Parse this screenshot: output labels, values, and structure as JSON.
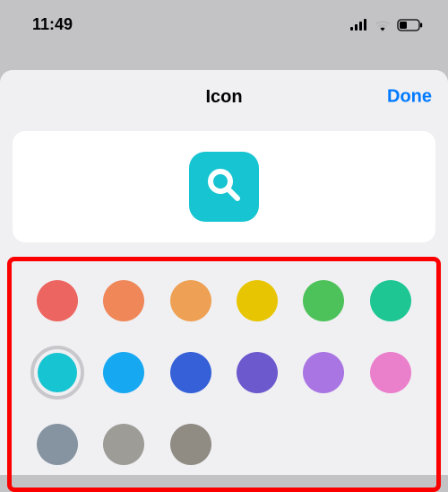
{
  "statusBar": {
    "time": "11:49"
  },
  "sheet": {
    "title": "Icon",
    "doneLabel": "Done"
  },
  "preview": {
    "iconName": "search-icon",
    "bgColor": "#17c4d1"
  },
  "colors": [
    {
      "name": "red",
      "hex": "#ec6560",
      "selected": false
    },
    {
      "name": "orange",
      "hex": "#ef8759",
      "selected": false
    },
    {
      "name": "amber",
      "hex": "#eea154",
      "selected": false
    },
    {
      "name": "yellow",
      "hex": "#e7c502",
      "selected": false
    },
    {
      "name": "green",
      "hex": "#4ec25a",
      "selected": false
    },
    {
      "name": "teal",
      "hex": "#1ec693",
      "selected": false
    },
    {
      "name": "cyan",
      "hex": "#17c4d1",
      "selected": true
    },
    {
      "name": "sky",
      "hex": "#17a8f2",
      "selected": false
    },
    {
      "name": "blue",
      "hex": "#3560d7",
      "selected": false
    },
    {
      "name": "indigo",
      "hex": "#6b59cd",
      "selected": false
    },
    {
      "name": "violet",
      "hex": "#a975e3",
      "selected": false
    },
    {
      "name": "pink",
      "hex": "#ea7fcb",
      "selected": false
    },
    {
      "name": "slate",
      "hex": "#8693a0",
      "selected": false
    },
    {
      "name": "gray",
      "hex": "#9d9c97",
      "selected": false
    },
    {
      "name": "warm-gray",
      "hex": "#908b83",
      "selected": false
    }
  ]
}
